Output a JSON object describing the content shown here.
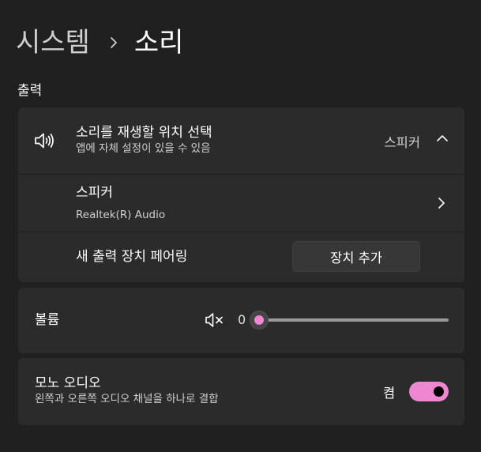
{
  "header": {
    "breadcrumb_parent": "시스템",
    "breadcrumb_current": "소리"
  },
  "output": {
    "section_label": "출력",
    "select_location": {
      "title": "소리를 재생할 위치 선택",
      "subtitle": "앱에 자체 설정이 있을 수 있음",
      "value": "스피커",
      "icon": "speaker-icon"
    },
    "device": {
      "title": "스피커",
      "subtitle": "Realtek(R) Audio"
    },
    "pair": {
      "title": "새 출력 장치 페어링",
      "button_label": "장치 추가"
    }
  },
  "volume": {
    "label": "볼륨",
    "value": "0",
    "level": 0,
    "icon": "speaker-muted-icon"
  },
  "mono_audio": {
    "title": "모노 오디오",
    "subtitle": "왼쪽과 오른쪽 오디오 채널을 하나로 결합",
    "state_label": "켬",
    "enabled": true
  },
  "colors": {
    "accent": "#ee86d2",
    "background": "#202020",
    "card": "#2b2b2b"
  }
}
